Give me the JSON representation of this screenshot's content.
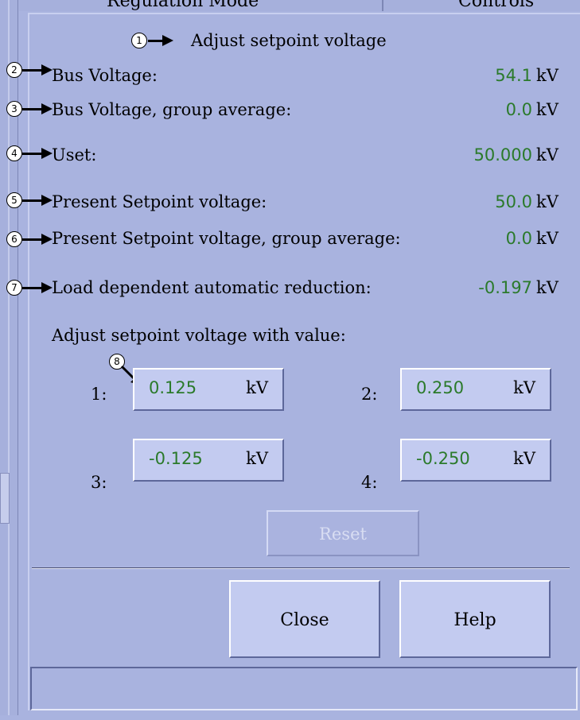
{
  "tabs": [
    "Regulation Mode",
    "Controls"
  ],
  "title": "Adjust setpoint voltage",
  "readings": [
    {
      "marker": "2",
      "label": "Bus Voltage:",
      "value": "54.1",
      "unit": "kV"
    },
    {
      "marker": "3",
      "label": "Bus Voltage, group average:",
      "value": "0.0",
      "unit": "kV"
    },
    {
      "marker": "4",
      "label": "Uset:",
      "value": "50.000",
      "unit": "kV"
    },
    {
      "marker": "5",
      "label": "Present Setpoint voltage:",
      "value": "50.0",
      "unit": "kV"
    },
    {
      "marker": "6",
      "label": "Present Setpoint voltage, group average:",
      "value": "0.0",
      "unit": "kV"
    },
    {
      "marker": "7",
      "label": "Load dependent automatic reduction:",
      "value": "-0.197",
      "unit": "kV"
    }
  ],
  "title_marker": "1",
  "adjust_label": "Adjust setpoint voltage with value:",
  "adjust_marker": "8",
  "adjust_buttons": [
    {
      "num": "1:",
      "value": "0.125",
      "unit": "kV"
    },
    {
      "num": "2:",
      "value": "0.250",
      "unit": "kV"
    },
    {
      "num": "3:",
      "value": "-0.125",
      "unit": "kV"
    },
    {
      "num": "4:",
      "value": "-0.250",
      "unit": "kV"
    }
  ],
  "reset_label": "Reset",
  "close_label": "Close",
  "help_label": "Help",
  "status_text": "",
  "colors": {
    "background": "#a9b3df",
    "value_green": "#2b7a2b",
    "button_face": "#c3cbf0",
    "disabled_text": "#d8ddf2"
  }
}
